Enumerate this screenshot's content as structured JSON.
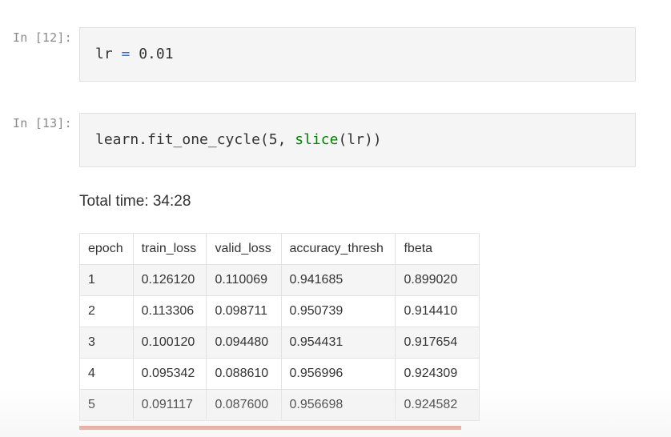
{
  "cells": [
    {
      "prompt": "In [12]:",
      "code": {
        "var": "lr",
        "op": " = ",
        "value": "0.01"
      }
    },
    {
      "prompt": "In [13]:",
      "code": {
        "prefix": "learn.fit_one_cycle(5, ",
        "builtin": "slice",
        "suffix": "(lr))"
      }
    }
  ],
  "output": {
    "total_time": "Total time: 34:28",
    "table": {
      "headers": [
        "epoch",
        "train_loss",
        "valid_loss",
        "accuracy_thresh",
        "fbeta"
      ],
      "rows": [
        [
          "1",
          "0.126120",
          "0.110069",
          "0.941685",
          "0.899020"
        ],
        [
          "2",
          "0.113306",
          "0.098711",
          "0.950739",
          "0.914410"
        ],
        [
          "3",
          "0.100120",
          "0.094480",
          "0.954431",
          "0.917654"
        ],
        [
          "4",
          "0.095342",
          "0.088610",
          "0.956996",
          "0.924309"
        ],
        [
          "5",
          "0.091117",
          "0.087600",
          "0.956698",
          "0.924582"
        ]
      ]
    },
    "progress_fraction": 1.0
  },
  "colors": {
    "operator": "#2a6fdb",
    "builtin": "#008000",
    "progress": "#d9876a"
  }
}
